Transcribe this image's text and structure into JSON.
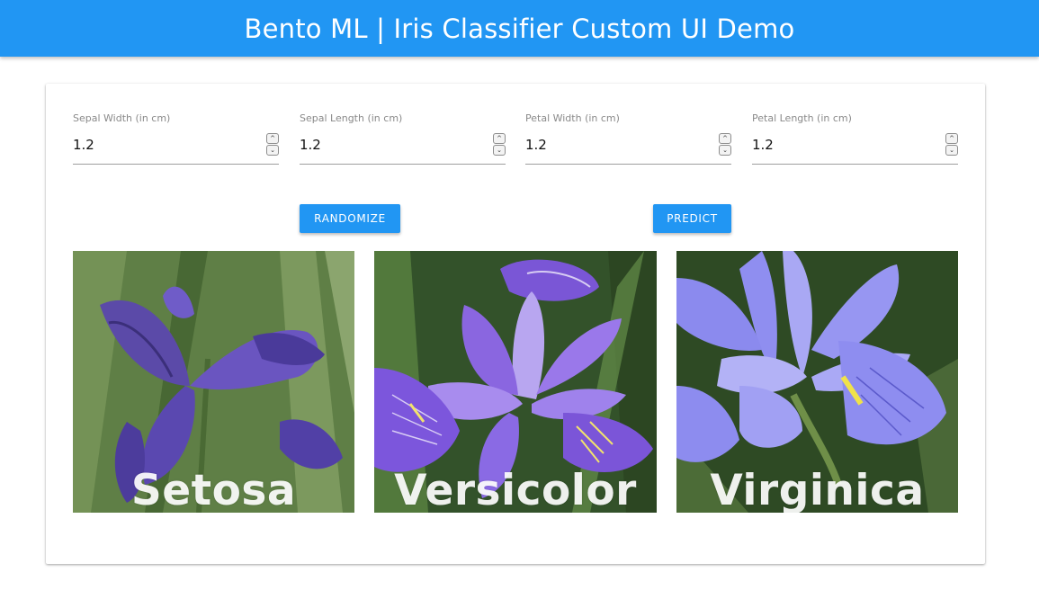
{
  "header": {
    "title": "Bento ML | Iris Classifier Custom UI Demo"
  },
  "fields": [
    {
      "label": "Sepal Width (in cm)",
      "value": "1.2",
      "spinner_up_icon": "chevron-up-icon",
      "spinner_down_icon": "chevron-down-icon"
    },
    {
      "label": "Sepal Length (in cm)",
      "value": "1.2",
      "spinner_up_icon": "chevron-up-icon",
      "spinner_down_icon": "chevron-down-icon"
    },
    {
      "label": "Petal Width (in cm)",
      "value": "1.2",
      "spinner_up_icon": "chevron-up-icon",
      "spinner_down_icon": "chevron-down-icon"
    },
    {
      "label": "Petal Length (in cm)",
      "value": "1.2",
      "spinner_up_icon": "chevron-up-icon",
      "spinner_down_icon": "chevron-down-icon"
    }
  ],
  "actions": {
    "randomize_label": "RANDOMIZE",
    "predict_label": "PREDICT"
  },
  "images": [
    {
      "caption": "Setosa"
    },
    {
      "caption": "Versicolor"
    },
    {
      "caption": "Virginica"
    }
  ],
  "colors": {
    "primary": "#2196f3",
    "text_on_primary": "#ffffff",
    "label": "#8a8a8a",
    "underline": "#9e9e9e"
  }
}
